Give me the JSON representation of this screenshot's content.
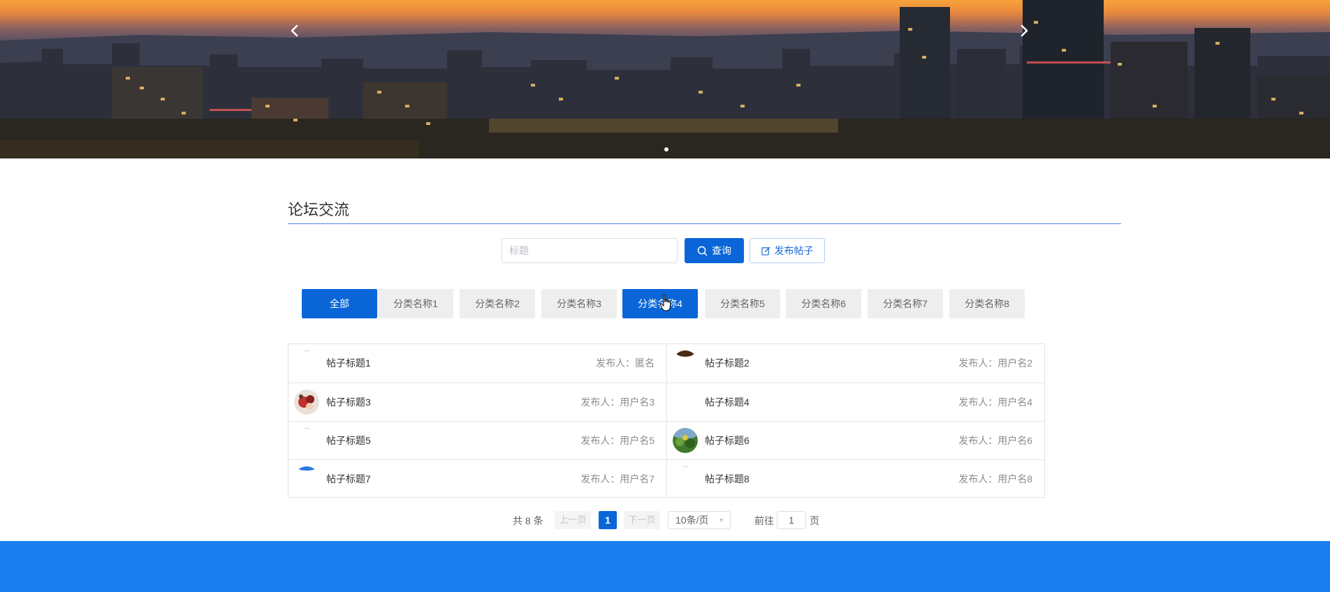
{
  "colors": {
    "primary": "#0a66d7",
    "title_rule": "#4a86e8",
    "footer": "#1a7ef0",
    "tab_inactive": "#eeeeee"
  },
  "banner": {
    "prev_icon": "chevron-left-icon",
    "next_icon": "chevron-right-icon",
    "active_slide": 1,
    "slide_count": 1
  },
  "section": {
    "title": "论坛交流"
  },
  "search": {
    "placeholder": "标题",
    "value": "",
    "query_label": "查询",
    "query_icon": "search-icon",
    "publish_label": "发布帖子",
    "publish_icon": "edit-icon"
  },
  "categories": {
    "active_index": 4,
    "items": [
      {
        "label": "全部"
      },
      {
        "label": "分类名称1"
      },
      {
        "label": "分类名称2"
      },
      {
        "label": "分类名称3"
      },
      {
        "label": "分类名称4"
      },
      {
        "label": "分类名称5"
      },
      {
        "label": "分类名称6"
      },
      {
        "label": "分类名称7"
      },
      {
        "label": "分类名称8"
      }
    ]
  },
  "posts": {
    "items": [
      {
        "title": "帖子标题1",
        "author": "发布人：匿名",
        "avatar": "blank"
      },
      {
        "title": "帖子标题2",
        "author": "发布人：用户名2",
        "avatar": "brown"
      },
      {
        "title": "帖子标题3",
        "author": "发布人：用户名3",
        "avatar": "photo-red"
      },
      {
        "title": "帖子标题4",
        "author": "发布人：用户名4",
        "avatar": "blank"
      },
      {
        "title": "帖子标题5",
        "author": "发布人：用户名5",
        "avatar": "blank"
      },
      {
        "title": "帖子标题6",
        "author": "发布人：用户名6",
        "avatar": "photo-green"
      },
      {
        "title": "帖子标题7",
        "author": "发布人：用户名7",
        "avatar": "blue"
      },
      {
        "title": "帖子标题8",
        "author": "发布人：用户名8",
        "avatar": "blank"
      }
    ]
  },
  "pagination": {
    "total_text": "共 8 条",
    "prev_label": "上一页",
    "next_label": "下一页",
    "current_page": "1",
    "page_size": "10条/页",
    "goto_label": "前往",
    "goto_value": "1",
    "goto_suffix": "页"
  }
}
